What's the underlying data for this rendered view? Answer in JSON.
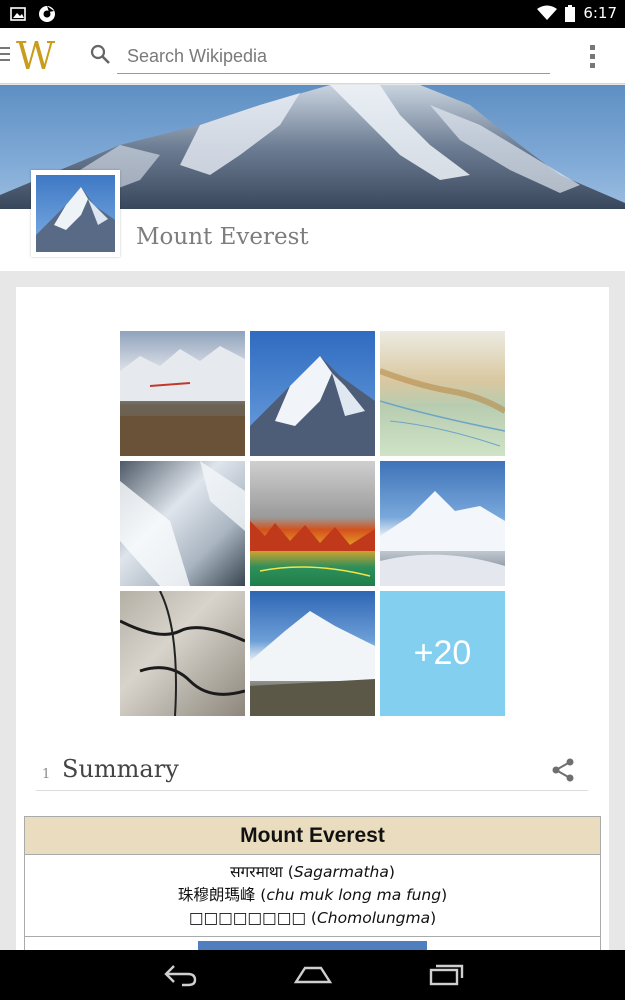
{
  "status_bar": {
    "time": "6:17",
    "icons": [
      "image-notification-icon",
      "chrome-notification-icon",
      "wifi-icon",
      "battery-icon"
    ]
  },
  "app_bar": {
    "logo_text": "W",
    "search_placeholder": "Search Wikipedia"
  },
  "article": {
    "title": "Mount Everest"
  },
  "gallery": {
    "more_count": "+20",
    "images": [
      "labeled-himalaya-photo",
      "everest-summit-photo",
      "nepal-relief-map",
      "everest-aerial-photo",
      "himalaya-elevation-map",
      "everest-aerial-clouds-photo",
      "everest-glacier-map",
      "everest-north-face-photo"
    ]
  },
  "summary": {
    "section_number": "1",
    "section_title": "Summary"
  },
  "infobox": {
    "title": "Mount Everest",
    "names": [
      {
        "native": "सगरमाथा",
        "romanized": "Sagarmatha"
      },
      {
        "native": "珠穆朗瑪峰",
        "romanized": "chu muk long ma fung"
      },
      {
        "native": "□□□□□□□□",
        "romanized": "Chomolungma"
      }
    ]
  },
  "colors": {
    "logo": "#c99c1d",
    "more_tile": "#83cff0",
    "infobox_header": "#eadcbe"
  }
}
